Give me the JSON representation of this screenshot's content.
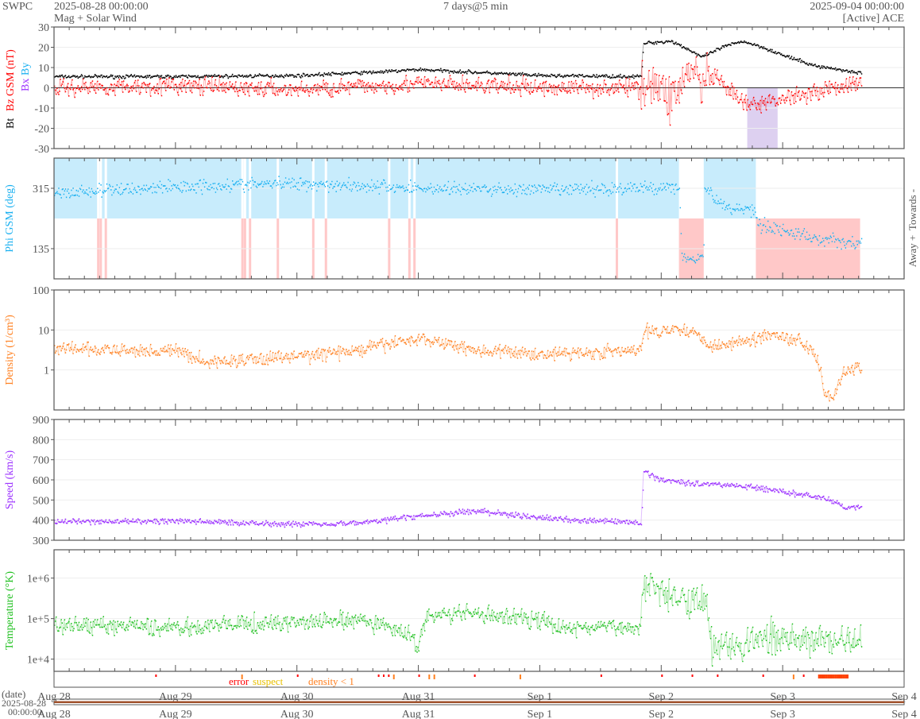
{
  "header": {
    "org": "SWPC",
    "start": "2025-08-28 00:00:00",
    "subtitle": "Mag + Solar Wind",
    "span": "7 days@5 min",
    "end": "2025-09-04 00:00:00",
    "source": "[Active] ACE"
  },
  "chart_data": [
    {
      "type": "line",
      "title": "Magnetic field",
      "ylabel_parts": [
        "Bt",
        "Bz GSM (nT)",
        "Bx",
        "By"
      ],
      "ylim": [
        -30,
        30
      ],
      "yticks": [
        -30,
        -20,
        -10,
        0,
        10,
        20,
        30
      ],
      "series": [
        {
          "name": "Bt",
          "color": "#000000",
          "x_hours": [
            0,
            24,
            48,
            66,
            72,
            96,
            116,
            116.5,
            122,
            126,
            128,
            132,
            136,
            140,
            144,
            150,
            160
          ],
          "values": [
            5.5,
            5.5,
            6,
            8,
            9,
            6,
            5.5,
            22,
            23,
            18,
            15,
            20,
            23,
            20,
            16,
            11,
            7
          ],
          "noise": 0.6
        },
        {
          "name": "Bz GSM",
          "color": "#ff0000",
          "x_hours": [
            0,
            24,
            48,
            72,
            96,
            116,
            116.5,
            122,
            126,
            128,
            130,
            134,
            137,
            140,
            144,
            150,
            156,
            160
          ],
          "values": [
            0,
            1,
            -1,
            2,
            0,
            0,
            5,
            -5,
            10,
            0,
            6,
            -3,
            -9,
            -8,
            -5,
            -2,
            1,
            2
          ],
          "noise": 3
        }
      ]
    },
    {
      "type": "scatter",
      "title": "Phi",
      "ylabel": "Phi GSM (deg)",
      "ylim": [
        45,
        405
      ],
      "yticks": [
        135,
        315
      ],
      "right_labels": [
        "Towards -",
        "Away +"
      ],
      "series": [
        {
          "name": "Phi GSM",
          "color": "#1ab0f0",
          "x_hours": [
            0,
            24,
            48,
            72,
            96,
            116,
            123.5,
            124,
            128.3,
            128.5,
            132,
            138.5,
            139,
            150,
            159.3
          ],
          "values": [
            300,
            320,
            330,
            315,
            310,
            315,
            320,
            110,
            110,
            320,
            260,
            250,
            210,
            165,
            150
          ],
          "noise": 14
        }
      ]
    },
    {
      "type": "line",
      "title": "Density",
      "ylabel": "Density (1/cm³)",
      "scale": "log",
      "ylim": [
        0.1,
        100
      ],
      "yticks": [
        1,
        10,
        100
      ],
      "ytick_labels": [
        "1",
        "10",
        "100"
      ],
      "series": [
        {
          "name": "Density",
          "color": "#ff8020",
          "x_hours": [
            0,
            12,
            24,
            30,
            48,
            60,
            72,
            84,
            96,
            116,
            116.5,
            124,
            130,
            136,
            142,
            146,
            150,
            152,
            154,
            157,
            160
          ],
          "values": [
            3.5,
            3,
            3,
            1.5,
            2.2,
            3,
            6,
            3,
            2.5,
            3,
            9,
            11,
            4,
            5,
            8,
            6,
            3,
            0.3,
            0.2,
            1,
            1.3
          ],
          "noise": 0.12
        }
      ]
    },
    {
      "type": "line",
      "title": "Speed",
      "ylabel": "Speed (km/s)",
      "ylim": [
        300,
        900
      ],
      "yticks": [
        300,
        400,
        500,
        600,
        700,
        800,
        900
      ],
      "series": [
        {
          "name": "Speed",
          "color": "#9b30ff",
          "x_hours": [
            0,
            24,
            48,
            60,
            72,
            84,
            96,
            116,
            116.5,
            120,
            128,
            136,
            144,
            152,
            156,
            160
          ],
          "values": [
            390,
            395,
            380,
            385,
            420,
            445,
            410,
            385,
            640,
            600,
            580,
            570,
            540,
            510,
            465,
            460
          ],
          "noise": 10
        }
      ]
    },
    {
      "type": "line",
      "title": "Temperature",
      "ylabel": "Temperature (°K)",
      "scale": "log",
      "ylim": [
        5000,
        5000000
      ],
      "yticks": [
        10000,
        100000,
        1000000
      ],
      "ytick_labels": [
        "1e+4",
        "1e+5",
        "1e+6"
      ],
      "series": [
        {
          "name": "Temperature",
          "color": "#20c020",
          "x_hours": [
            0,
            24,
            48,
            60,
            70,
            72,
            74,
            84,
            96,
            100,
            116,
            116.5,
            122,
            128,
            130,
            140,
            150,
            160
          ],
          "values": [
            70000,
            60000,
            80000,
            90000,
            40000,
            20000,
            120000,
            130000,
            90000,
            60000,
            60000,
            800000,
            400000,
            300000,
            20000,
            30000,
            30000,
            25000
          ],
          "noise": 0.15
        }
      ]
    }
  ],
  "flags": {
    "labels": [
      "error",
      "suspect",
      "density < 1"
    ],
    "colors": [
      "#ff0000",
      "#e8c000",
      "#ff8020"
    ]
  },
  "xaxis": {
    "ticks": [
      "Aug 28",
      "Aug 29",
      "Aug 30",
      "Aug 31",
      "Sep 1",
      "Sep 2",
      "Sep 3",
      "Sep 4"
    ],
    "date_label": "(date)",
    "start_label_1": "2025-08-28",
    "start_label_2": "00:00:00"
  }
}
